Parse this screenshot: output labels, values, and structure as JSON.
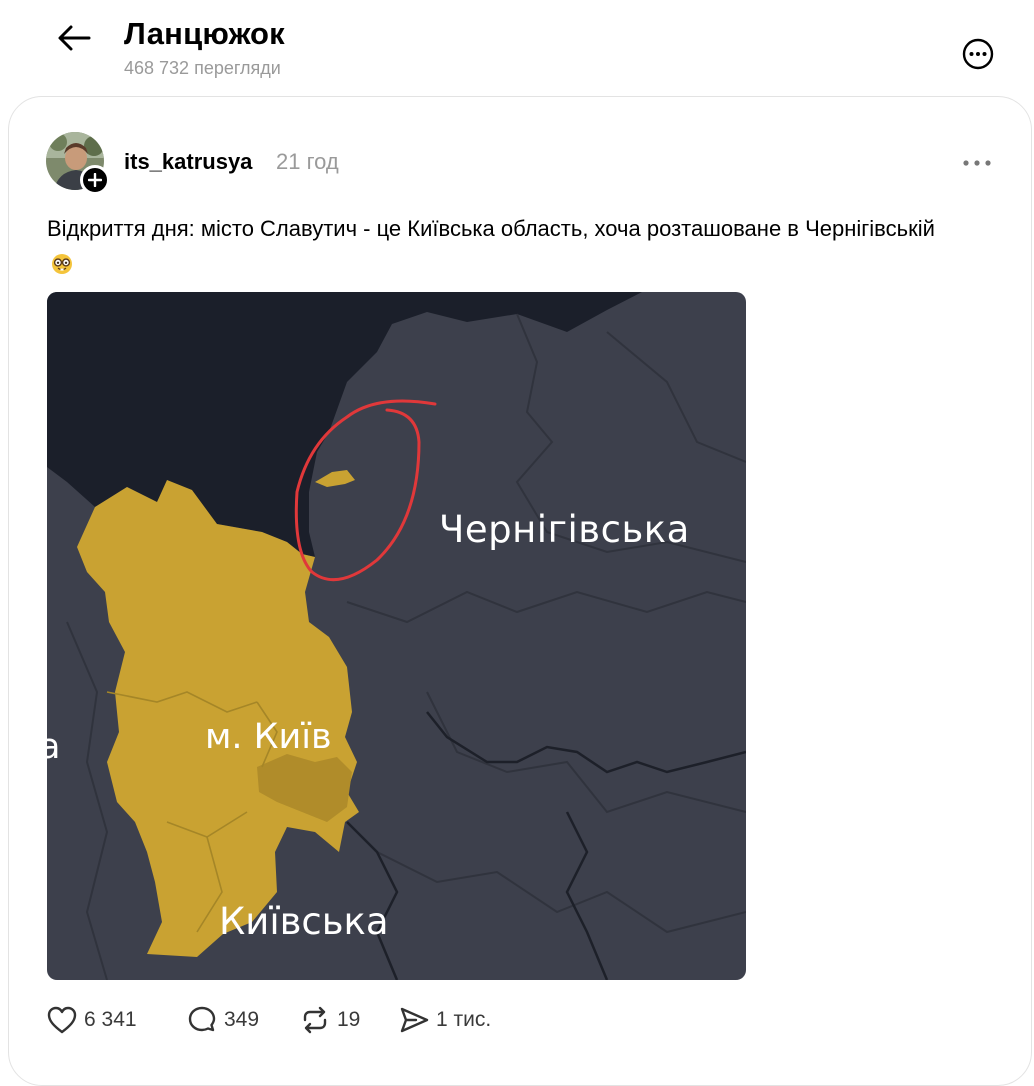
{
  "header": {
    "title": "Ланцюжок",
    "views": "468 732 перегляди"
  },
  "post": {
    "username": "its_katrusya",
    "time": "21 год",
    "text": "Відкриття дня: місто Славутич - це Київська область, хоча розташоване в Чернігівській",
    "emoji": "nerd-face-emoji",
    "image": {
      "labels": {
        "chernihiv": "Чернігівська",
        "kyiv_city": "м. Київ",
        "kyiv_oblast": "Київська",
        "left_fragment": "а"
      },
      "colors": {
        "background_region": "#3d404c",
        "kyiv_region": "#c9a232",
        "belarus": "#1b1f2a",
        "circle": "#e0383a",
        "label_text": "#ffffff"
      }
    },
    "actions": {
      "likes": "6 341",
      "comments": "349",
      "reposts": "19",
      "shares": "1 тис."
    }
  }
}
